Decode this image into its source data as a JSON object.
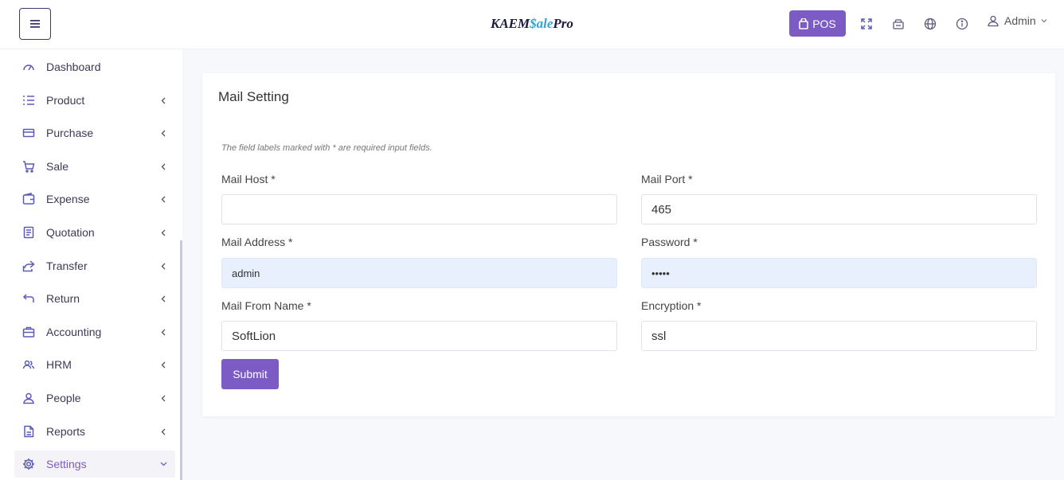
{
  "header": {
    "brand_part1": "KAEM",
    "brand_part2": "$ale",
    "brand_part3": "Pro",
    "pos_label": "POS",
    "user_label": "Admin"
  },
  "sidebar": {
    "items": [
      {
        "label": "Dashboard",
        "icon": "dashboard-icon",
        "has_chevron": false
      },
      {
        "label": "Product",
        "icon": "list-icon",
        "has_chevron": true
      },
      {
        "label": "Purchase",
        "icon": "card-icon",
        "has_chevron": true
      },
      {
        "label": "Sale",
        "icon": "cart-icon",
        "has_chevron": true
      },
      {
        "label": "Expense",
        "icon": "wallet-icon",
        "has_chevron": true
      },
      {
        "label": "Quotation",
        "icon": "document-icon",
        "has_chevron": true
      },
      {
        "label": "Transfer",
        "icon": "share-icon",
        "has_chevron": true
      },
      {
        "label": "Return",
        "icon": "return-icon",
        "has_chevron": true
      },
      {
        "label": "Accounting",
        "icon": "briefcase-icon",
        "has_chevron": true
      },
      {
        "label": "HRM",
        "icon": "users-icon",
        "has_chevron": true
      },
      {
        "label": "People",
        "icon": "user-icon",
        "has_chevron": true
      },
      {
        "label": "Reports",
        "icon": "file-icon",
        "has_chevron": true
      },
      {
        "label": "Settings",
        "icon": "gear-icon",
        "has_chevron": true
      }
    ],
    "active": "Settings"
  },
  "form": {
    "title": "Mail Setting",
    "note": "The field labels marked with * are required input fields.",
    "mail_host": {
      "label": "Mail Host *",
      "value": ""
    },
    "mail_port": {
      "label": "Mail Port *",
      "value": "465"
    },
    "mail_address": {
      "label": "Mail Address *",
      "value": "admin"
    },
    "password": {
      "label": "Password *",
      "value": "•••••"
    },
    "mail_from_name": {
      "label": "Mail From Name *",
      "value": "SoftLion"
    },
    "encryption": {
      "label": "Encryption *",
      "value": "ssl"
    },
    "submit_label": "Submit"
  },
  "colors": {
    "accent": "#7c5cc4",
    "brand_blue": "#2fa4d9",
    "autofill": "#e8f0fe"
  }
}
